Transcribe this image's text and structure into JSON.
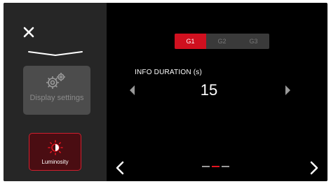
{
  "sidebar": {
    "close_icon": "close-icon",
    "display_settings": {
      "label": "Display settings",
      "icon": "gear-icon"
    },
    "luminosity": {
      "label": "Luminosity",
      "icon": "brightness-icon"
    }
  },
  "tabs": [
    {
      "label": "G1",
      "active": true
    },
    {
      "label": "G2",
      "active": false
    },
    {
      "label": "G3",
      "active": false
    }
  ],
  "info": {
    "label": "INFO DURATION (s)",
    "value": "15"
  },
  "pagination": {
    "current": 2,
    "total": 3
  },
  "colors": {
    "accent": "#d0101f",
    "sidebar": "#262626",
    "background": "#000000"
  }
}
